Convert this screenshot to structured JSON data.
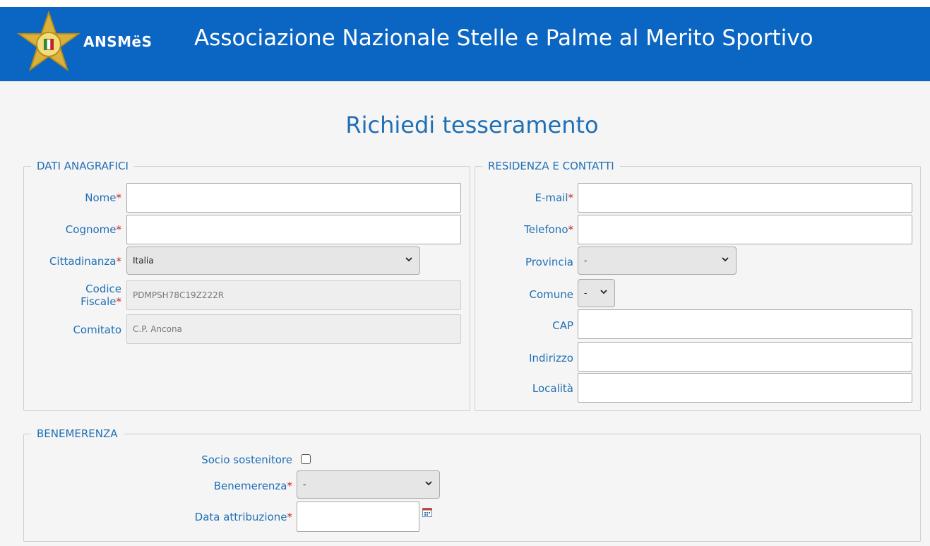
{
  "header": {
    "logo_text": "ANSMëS",
    "title": "Associazione Nazionale Stelle e Palme al Merito Sportivo",
    "colors": {
      "bar": "#0a66c2",
      "text": "#ffffff"
    }
  },
  "page_title": "Richiedi tesseramento",
  "anagrafici": {
    "legend": "DATI ANAGRAFICI",
    "nome_label": "Nome",
    "nome_value": "",
    "cognome_label": "Cognome",
    "cognome_value": "",
    "cittadinanza_label": "Cittadinanza",
    "cittadinanza_value": "Italia",
    "cf_label_1": "Codice",
    "cf_label_2": "Fiscale",
    "cf_value": "PDMPSH78C19Z222R",
    "comitato_label": "Comitato",
    "comitato_value": "C.P. Ancona"
  },
  "residenza": {
    "legend": "RESIDENZA E CONTATTI",
    "email_label": "E-mail",
    "email_value": "",
    "telefono_label": "Telefono",
    "telefono_value": "",
    "provincia_label": "Provincia",
    "provincia_value": "-",
    "comune_label": "Comune",
    "comune_value": "-",
    "cap_label": "CAP",
    "cap_value": "",
    "indirizzo_label": "Indirizzo",
    "indirizzo_value": "",
    "localita_label": "Località",
    "localita_value": ""
  },
  "benemerenza": {
    "legend": "BENEMERENZA",
    "socio_label": "Socio sostenitore",
    "socio_checked": false,
    "benemerenza_label": "Benemerenza",
    "benemerenza_value": "-",
    "data_label": "Data attribuzione",
    "data_value": ""
  },
  "required_mark": "*",
  "icons": {
    "logo": "star-emblem-icon",
    "chevron": "chevron-down-icon",
    "calendar": "calendar-icon"
  },
  "colors": {
    "label": "#1f6fb5",
    "required": "#cc1f1f",
    "background": "#f5f5f5"
  }
}
